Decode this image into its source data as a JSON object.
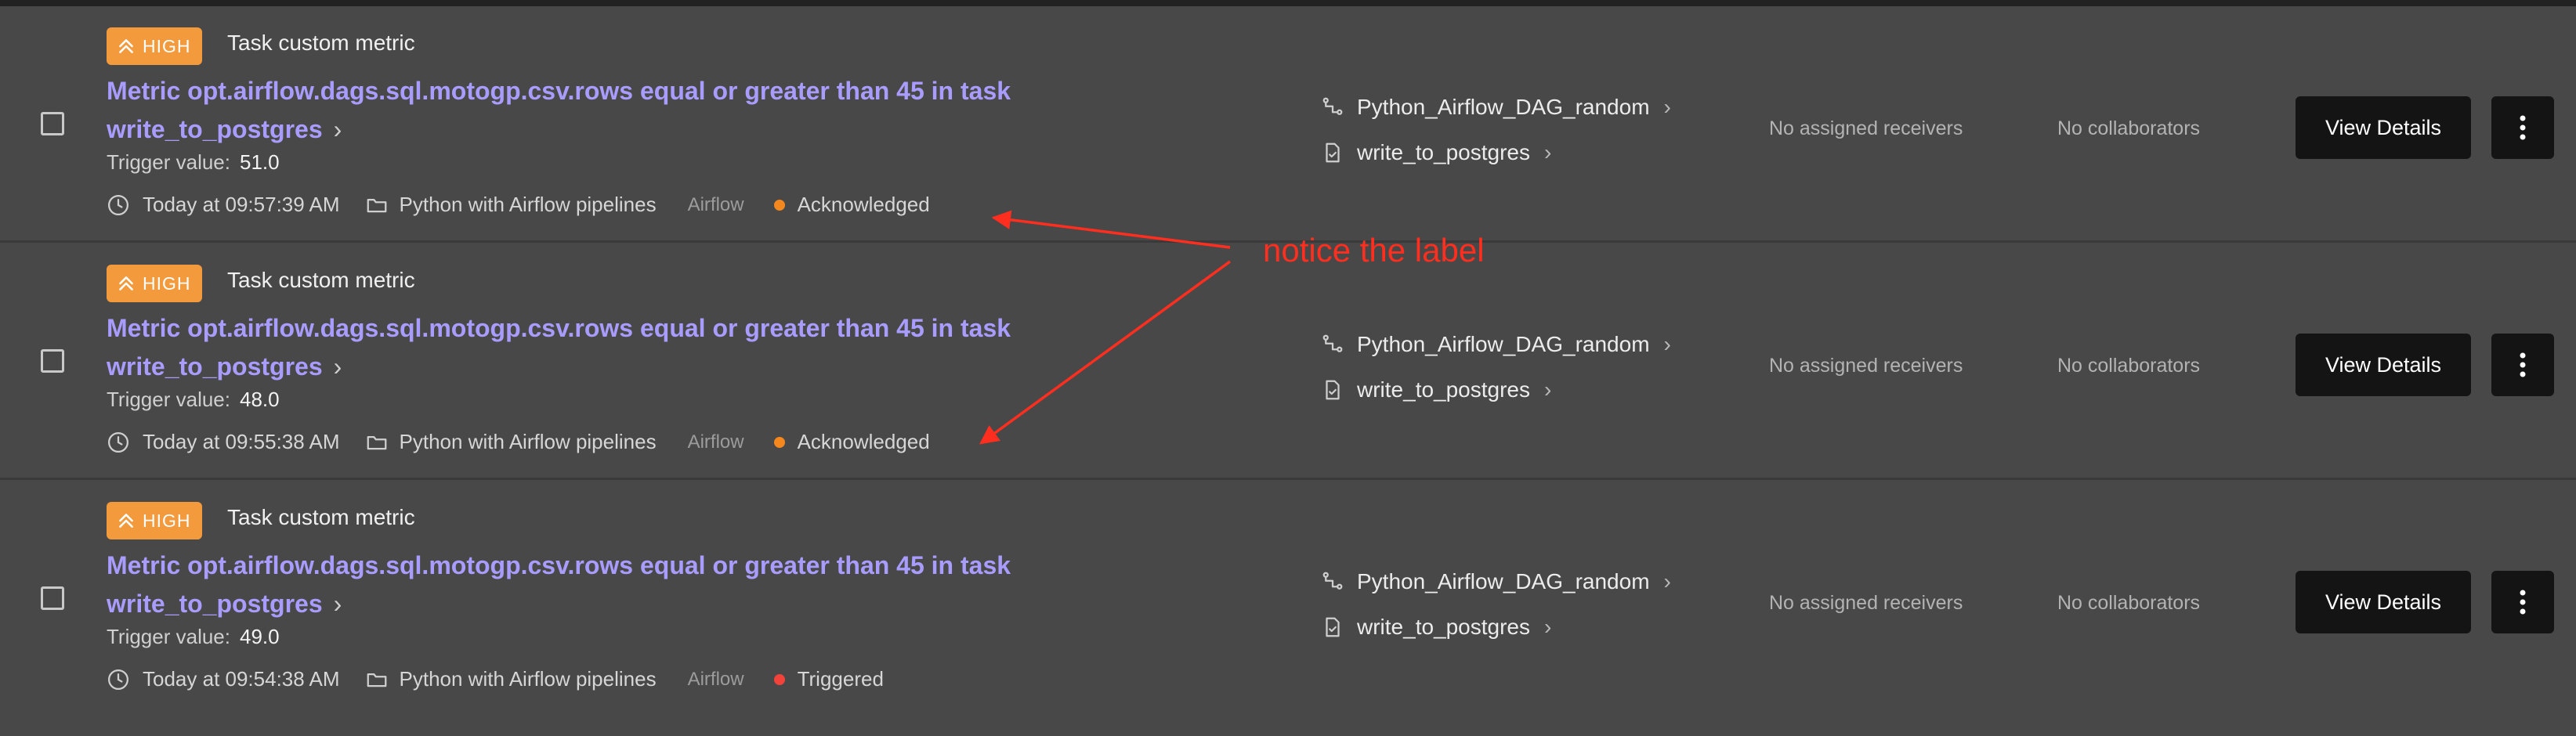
{
  "alerts": [
    {
      "severity": "HIGH",
      "type": "Task custom metric",
      "title": "Metric opt.airflow.dags.sql.motogp.csv.rows equal or greater than 45 in task write_to_postgres",
      "trigger_label": "Trigger value:",
      "trigger_value": "51.0",
      "time": "Today at 09:57:39 AM",
      "pipeline": "Python with Airflow pipelines",
      "source": "Airflow",
      "status": "Acknowledged",
      "status_color": "#f5871f",
      "dag": "Python_Airflow_DAG_random",
      "task": "write_to_postgres",
      "receivers": "No assigned receivers",
      "collaborators": "No collaborators",
      "view_label": "View Details"
    },
    {
      "severity": "HIGH",
      "type": "Task custom metric",
      "title": "Metric opt.airflow.dags.sql.motogp.csv.rows equal or greater than 45 in task write_to_postgres",
      "trigger_label": "Trigger value:",
      "trigger_value": "48.0",
      "time": "Today at 09:55:38 AM",
      "pipeline": "Python with Airflow pipelines",
      "source": "Airflow",
      "status": "Acknowledged",
      "status_color": "#f5871f",
      "dag": "Python_Airflow_DAG_random",
      "task": "write_to_postgres",
      "receivers": "No assigned receivers",
      "collaborators": "No collaborators",
      "view_label": "View Details"
    },
    {
      "severity": "HIGH",
      "type": "Task custom metric",
      "title": "Metric opt.airflow.dags.sql.motogp.csv.rows equal or greater than 45 in task write_to_postgres",
      "trigger_label": "Trigger value:",
      "trigger_value": "49.0",
      "time": "Today at 09:54:38 AM",
      "pipeline": "Python with Airflow pipelines",
      "source": "Airflow",
      "status": "Triggered",
      "status_color": "#f2423a",
      "dag": "Python_Airflow_DAG_random",
      "task": "write_to_postgres",
      "receivers": "No assigned receivers",
      "collaborators": "No collaborators",
      "view_label": "View Details"
    }
  ],
  "annotation": {
    "text": "notice the label",
    "color": "#ff2e1f"
  },
  "colors": {
    "background": "#484848",
    "badge": "#f39a3d",
    "title": "#a99cff",
    "button": "#141414"
  },
  "icons": [
    "priority-up-icon",
    "clock-icon",
    "folder-icon",
    "dag-icon",
    "task-icon",
    "chevron-right-icon",
    "more-vertical-icon"
  ]
}
